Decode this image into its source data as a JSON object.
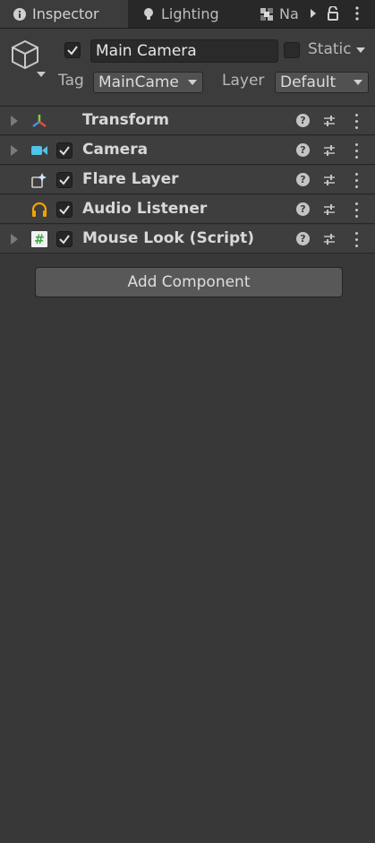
{
  "tabs": [
    {
      "label": "Inspector",
      "icon": "info-icon"
    },
    {
      "label": "Lighting",
      "icon": "lightbulb-icon"
    },
    {
      "label": "Na",
      "icon": "navigation-icon"
    }
  ],
  "tab_menu_icons": [
    "chevron-right-icon",
    "lock-icon",
    "kebab-menu-icon"
  ],
  "object": {
    "icon": "cube-icon",
    "active": true,
    "name": "Main Camera",
    "static_checked": false,
    "static_label": "Static",
    "tag_label": "Tag",
    "tag_value": "MainCame",
    "layer_label": "Layer",
    "layer_value": "Default"
  },
  "components": [
    {
      "name": "Transform",
      "icon": "transform-icon",
      "foldout": true,
      "has_checkbox": false,
      "enabled": null
    },
    {
      "name": "Camera",
      "icon": "camera-icon",
      "foldout": true,
      "has_checkbox": true,
      "enabled": true
    },
    {
      "name": "Flare Layer",
      "icon": "flare-layer-icon",
      "foldout": false,
      "has_checkbox": true,
      "enabled": true
    },
    {
      "name": "Audio Listener",
      "icon": "headphones-icon",
      "foldout": false,
      "has_checkbox": true,
      "enabled": true
    },
    {
      "name": "Mouse Look (Script)",
      "icon": "csharp-script-icon",
      "foldout": true,
      "has_checkbox": true,
      "enabled": true
    }
  ],
  "component_actions": {
    "help_glyph": "?",
    "icons": [
      "help-icon",
      "presets-icon",
      "kebab-menu-icon"
    ]
  },
  "add_component_label": "Add Component",
  "colors": {
    "panel_bg": "#383838",
    "tab_bg": "#282828",
    "header_bg": "#3c3c3c",
    "component_bg": "#3e3e3e",
    "camera_icon": "#4fc3e8",
    "audio_icon": "#f0a500",
    "script_icon": "#3ea845"
  }
}
